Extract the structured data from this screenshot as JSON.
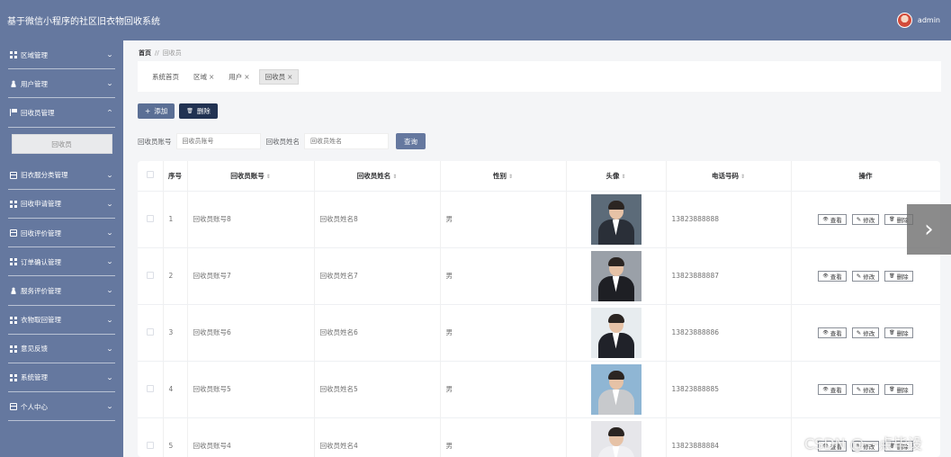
{
  "app": {
    "title": "基于微信小程序的社区旧衣物回收系统",
    "user": "admin"
  },
  "sidebar": {
    "items": [
      {
        "label": "区域管理",
        "icon": "grid-icon",
        "chevron": "⌄"
      },
      {
        "label": "用户管理",
        "icon": "person-icon",
        "chevron": "⌄"
      },
      {
        "label": "回收员管理",
        "icon": "flag-icon",
        "chevron": "⌃",
        "expanded": true
      },
      {
        "label": "旧衣服分类管理",
        "icon": "box-icon",
        "chevron": "⌄"
      },
      {
        "label": "回收申请管理",
        "icon": "grid-icon",
        "chevron": "⌄"
      },
      {
        "label": "回收评价管理",
        "icon": "box-icon",
        "chevron": "⌄"
      },
      {
        "label": "订单确认管理",
        "icon": "grid-icon",
        "chevron": "⌄"
      },
      {
        "label": "服务评价管理",
        "icon": "person-icon",
        "chevron": "⌄"
      },
      {
        "label": "衣物取回管理",
        "icon": "grid-icon",
        "chevron": "⌄"
      },
      {
        "label": "意见反馈",
        "icon": "grid-icon",
        "chevron": "⌄"
      },
      {
        "label": "系统管理",
        "icon": "grid-icon",
        "chevron": "⌄"
      },
      {
        "label": "个人中心",
        "icon": "box-icon",
        "chevron": "⌄"
      }
    ],
    "submenu": {
      "label": "回收员"
    }
  },
  "breadcrumb": {
    "home": "首页",
    "sep": "//",
    "current": "回收员"
  },
  "tags": [
    {
      "label": "系统首页",
      "closable": false,
      "active": false
    },
    {
      "label": "区域",
      "closable": true,
      "active": false
    },
    {
      "label": "用户",
      "closable": true,
      "active": false
    },
    {
      "label": "回收员",
      "closable": true,
      "active": true
    }
  ],
  "tag_close": "×",
  "toolbar": {
    "add_icon": "+",
    "add_label": "添加",
    "delete_icon": "🗑",
    "delete_label": "删除"
  },
  "search": {
    "account_label": "回收员账号",
    "account_placeholder": "回收员账号",
    "name_label": "回收员姓名",
    "name_placeholder": "回收员姓名",
    "query_label": "查询"
  },
  "table": {
    "headers": {
      "index": "序号",
      "account": "回收员账号",
      "name": "回收员姓名",
      "gender": "性别",
      "avatar": "头像",
      "phone": "电话号码",
      "ops": "操作"
    },
    "sort_icon": "⇕",
    "rows": [
      {
        "index": "1",
        "account": "回收员账号8",
        "name": "回收员姓名8",
        "gender": "男",
        "phone": "13823888888",
        "photo_bg": "#5c6b79",
        "suit": "#2a2f38"
      },
      {
        "index": "2",
        "account": "回收员账号7",
        "name": "回收员姓名7",
        "gender": "男",
        "phone": "13823888887",
        "photo_bg": "#9aa0a8",
        "suit": "#1e1f24"
      },
      {
        "index": "3",
        "account": "回收员账号6",
        "name": "回收员姓名6",
        "gender": "男",
        "phone": "13823888886",
        "photo_bg": "#e7ecef",
        "suit": "#202229"
      },
      {
        "index": "4",
        "account": "回收员账号5",
        "name": "回收员姓名5",
        "gender": "男",
        "phone": "13823888885",
        "photo_bg": "#8fb6d4",
        "suit": "#c7c9cc"
      },
      {
        "index": "5",
        "account": "回收员账号4",
        "name": "回收员姓名4",
        "gender": "男",
        "phone": "13823888884",
        "photo_bg": "#e6e6ea",
        "suit": "#f0f0f3"
      }
    ],
    "actions": {
      "view": "查看",
      "edit": "修改",
      "delete": "删除",
      "view_icon": "👁",
      "edit_icon": "✎",
      "delete_icon": "🗑"
    }
  },
  "carousel_next": "›",
  "watermark": "CSDN @一点毕设"
}
